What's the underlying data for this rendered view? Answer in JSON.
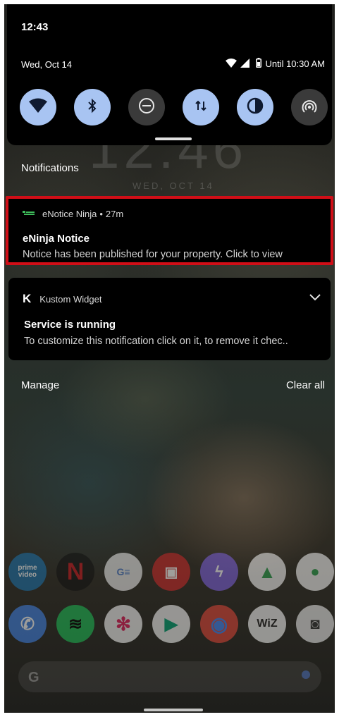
{
  "status": {
    "time": "12:43",
    "date": "Wed, Oct 14",
    "battery_text": "Until 10:30 AM"
  },
  "quick_tiles": [
    {
      "name": "wifi",
      "icon": "wifi-icon",
      "state": "on"
    },
    {
      "name": "bluetooth",
      "icon": "bluetooth-icon",
      "state": "on"
    },
    {
      "name": "do-not-disturb",
      "icon": "do-not-disturb-icon",
      "state": "off"
    },
    {
      "name": "mobile-data",
      "icon": "mobile-data-icon",
      "state": "on"
    },
    {
      "name": "dark-theme",
      "icon": "dark-theme-icon",
      "state": "on"
    },
    {
      "name": "hotspot",
      "icon": "hotspot-icon",
      "state": "off"
    }
  ],
  "notifications_label": "Notifications",
  "wallpaper": {
    "clock": "12:46",
    "date": "WED, OCT 14"
  },
  "notifications": {
    "enotice": {
      "app_name": "eNotice Ninja",
      "separator": "•",
      "time": "27m",
      "title": "eNinja Notice",
      "text": "Notice has been published for your property. Click to view"
    },
    "kustom": {
      "app_name": "Kustom Widget",
      "app_glyph": "K",
      "title": "Service is running",
      "text": "To customize this notification click on it, to remove it chec.."
    }
  },
  "footer": {
    "manage": "Manage",
    "clear_all": "Clear all"
  },
  "colors": {
    "tile_on": "#a8c4f2",
    "tile_off": "#3a3a3a",
    "highlight_border": "#d10e17"
  }
}
